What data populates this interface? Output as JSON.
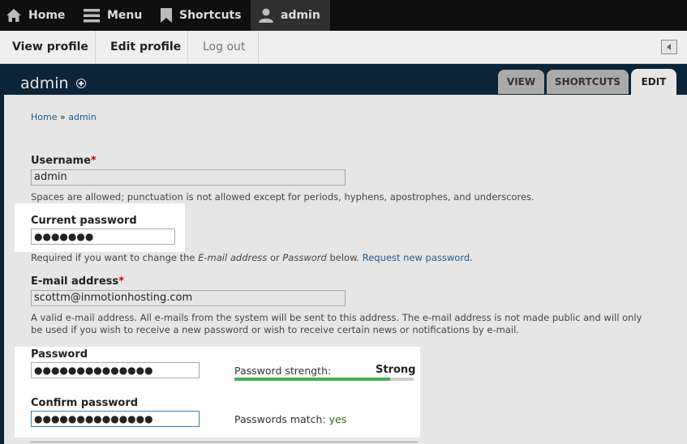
{
  "toolbar": {
    "home": "Home",
    "menu": "Menu",
    "shortcuts": "Shortcuts",
    "user": "admin"
  },
  "tray": {
    "view_profile": "View profile",
    "edit_profile": "Edit profile",
    "log_out": "Log out"
  },
  "header": {
    "title": "admin",
    "tabs": [
      "VIEW",
      "SHORTCUTS",
      "EDIT"
    ],
    "active_tab": "EDIT"
  },
  "breadcrumb": {
    "home": "Home",
    "sep": "»",
    "current": "admin"
  },
  "form": {
    "username": {
      "label": "Username",
      "required": "*",
      "value": "admin",
      "description": "Spaces are allowed; punctuation is not allowed except for periods, hyphens, apostrophes, and underscores."
    },
    "current_password": {
      "label": "Current password",
      "value": "●●●●●●●",
      "desc_prefix": "Required if you want to change the ",
      "desc_em1": "E-mail address",
      "desc_mid": " or ",
      "desc_em2": "Password",
      "desc_suffix": " below. ",
      "desc_link": "Request new password",
      "desc_end": "."
    },
    "email": {
      "label": "E-mail address",
      "required": "*",
      "value": "scottm@inmotionhosting.com",
      "description_line1": "A valid e-mail address. All e-mails from the system will be sent to this address. The e-mail address is not made public and will only",
      "description_line2": "be used if you wish to receive a new password or wish to receive certain news or notifications by e-mail."
    },
    "password": {
      "label": "Password",
      "value": "●●●●●●●●●●●●●●",
      "strength_label": "Password strength:",
      "strength_value": "Strong",
      "strength_fraction": 0.87
    },
    "confirm_password": {
      "label": "Confirm password",
      "value": "●●●●●●●●●●●●●●",
      "match_label": "Passwords match:",
      "match_value": "yes"
    }
  },
  "colors": {
    "toolbar_bg": "#0f0f0f",
    "header_bg": "#0c2437",
    "link": "#1e5b8f",
    "required": "#cc0000",
    "strength": "#4caf50"
  }
}
